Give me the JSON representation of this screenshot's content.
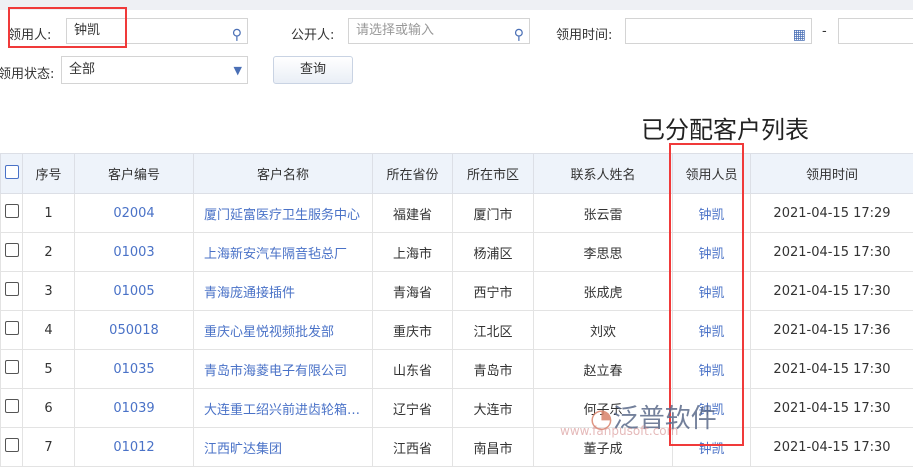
{
  "filters": {
    "receiver_label": "领用人:",
    "receiver_value": "钟凯",
    "public_label": "公开人:",
    "public_placeholder": "请选择或输入",
    "time_label": "领用时间:",
    "range_sep": "-",
    "status_label": "领用状态:",
    "status_value": "全部",
    "query_button": "查询"
  },
  "title": "已分配客户列表",
  "columns": [
    "序号",
    "客户编号",
    "客户名称",
    "所在省份",
    "所在市区",
    "联系人姓名",
    "领用人员",
    "领用时间"
  ],
  "rows": [
    [
      "1",
      "02004",
      "厦门延富医疗卫生服务中心",
      "福建省",
      "厦门市",
      "张云雷",
      "钟凯",
      "2021-04-15 17:29"
    ],
    [
      "2",
      "01003",
      "上海新安汽车隔音毡总厂",
      "上海市",
      "杨浦区",
      "李思思",
      "钟凯",
      "2021-04-15 17:30"
    ],
    [
      "3",
      "01005",
      "青海庞通接插件",
      "青海省",
      "西宁市",
      "张成虎",
      "钟凯",
      "2021-04-15 17:30"
    ],
    [
      "4",
      "050018",
      "重庆心星悦视频批发部",
      "重庆市",
      "江北区",
      "刘欢",
      "钟凯",
      "2021-04-15 17:36"
    ],
    [
      "5",
      "01035",
      "青岛市海菱电子有限公司",
      "山东省",
      "青岛市",
      "赵立春",
      "钟凯",
      "2021-04-15 17:30"
    ],
    [
      "6",
      "01039",
      "大连重工绍兴前进齿轮箱…",
      "辽宁省",
      "大连市",
      "何子乐",
      "钟凯",
      "2021-04-15 17:30"
    ],
    [
      "7",
      "01012",
      "江西旷达集团",
      "江西省",
      "南昌市",
      "董子成",
      "钟凯",
      "2021-04-15 17:30"
    ]
  ],
  "watermark": "泛普软件",
  "watermark_url": "www.fanpusoft.com"
}
